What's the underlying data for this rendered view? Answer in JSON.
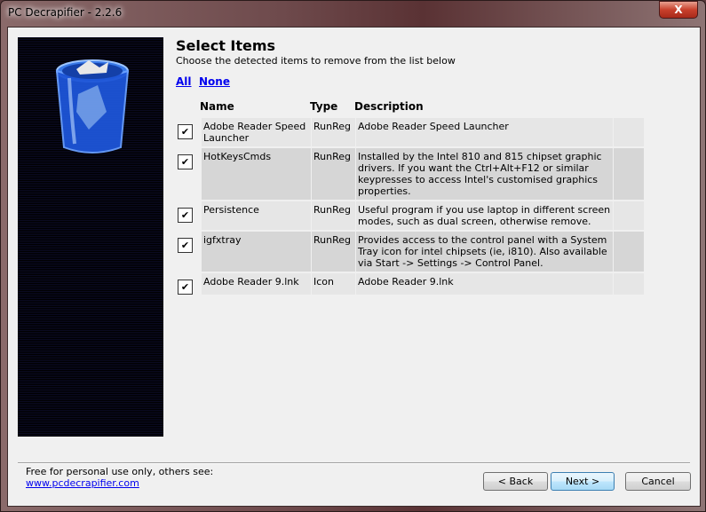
{
  "window": {
    "title": "PC Decrapifier - 2.2.6",
    "close_label": "X"
  },
  "header": {
    "title": "Select Items",
    "subtitle": "Choose the detected items to remove from the list below"
  },
  "selection": {
    "all": "All",
    "none": "None"
  },
  "table": {
    "columns": [
      "Name",
      "Type",
      "Description"
    ],
    "rows": [
      {
        "checked": true,
        "name": "Adobe Reader Speed Launcher",
        "type": "RunReg",
        "description": "Adobe Reader Speed Launcher"
      },
      {
        "checked": true,
        "name": "HotKeysCmds",
        "type": "RunReg",
        "description": "Installed by the Intel 810 and 815 chipset graphic drivers. If you want the Ctrl+Alt+F12 or similar keypresses to access Intel's customised graphics properties."
      },
      {
        "checked": true,
        "name": "Persistence",
        "type": "RunReg",
        "description": "Useful program if you use laptop in different screen modes, such as dual screen, otherwise remove."
      },
      {
        "checked": true,
        "name": "igfxtray",
        "type": "RunReg",
        "description": "Provides access to the control panel with a System Tray icon for intel chipsets (ie, i810). Also available via Start -> Settings -> Control Panel."
      },
      {
        "checked": true,
        "name": "Adobe Reader 9.lnk",
        "type": "Icon",
        "description": "Adobe Reader 9.lnk"
      }
    ]
  },
  "footer": {
    "note": "Free for personal use only, others see:",
    "link": "www.pcdecrapifier.com"
  },
  "buttons": {
    "back": "< Back",
    "next": "Next >",
    "cancel": "Cancel"
  },
  "check_glyph": "✔"
}
